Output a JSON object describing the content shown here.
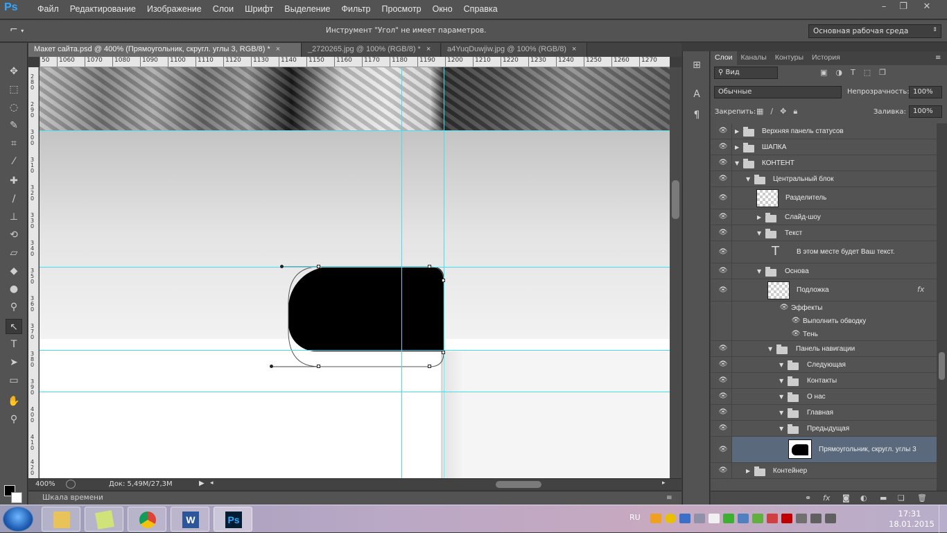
{
  "app": {
    "logo": "Ps"
  },
  "menu": [
    "Файл",
    "Редактирование",
    "Изображение",
    "Слои",
    "Шрифт",
    "Выделение",
    "Фильтр",
    "Просмотр",
    "Окно",
    "Справка"
  ],
  "window_controls": {
    "minimize": "–",
    "restore": "❐",
    "close": "✕"
  },
  "options": {
    "message": "Инструмент \"Угол\" не имеет параметров.",
    "workspace": "Основная рабочая среда"
  },
  "tabs": [
    {
      "label": "Макет сайта.psd @ 400% (Прямоугольник, скругл. углы 3, RGB/8) *",
      "close": "×"
    },
    {
      "label": "_2720265.jpg @ 100% (RGB/8) *",
      "close": "×"
    },
    {
      "label": "a4YuqDuwjiw.jpg @ 100% (RGB/8)",
      "close": "×"
    }
  ],
  "ruler_top": [
    "50",
    "1060",
    "1070",
    "1080",
    "1090",
    "1100",
    "1110",
    "1120",
    "1130",
    "1140",
    "1150",
    "1160",
    "1170",
    "1180",
    "1190",
    "1200",
    "1210",
    "1220",
    "1230",
    "1240",
    "1250",
    "1260",
    "1270"
  ],
  "ruler_left": [
    "280",
    "290",
    "300",
    "310",
    "320",
    "330",
    "340",
    "350",
    "360",
    "370",
    "380",
    "390",
    "400",
    "410",
    "420"
  ],
  "status": {
    "zoom": "400%",
    "doc": "Док: 5,49M/27,3M"
  },
  "timeline": {
    "label": "Шкала времени"
  },
  "panel_tabs": [
    "Слои",
    "Каналы",
    "Контуры",
    "История"
  ],
  "layers_controls": {
    "filter": "Вид",
    "blend_mode": "Обычные",
    "opacity_label": "Непрозрачность:",
    "opacity_value": "100%",
    "lock_label": "Закрепить:",
    "fill_label": "Заливка:",
    "fill_value": "100%"
  },
  "layers": [
    {
      "name": "Верхняя панель статусов",
      "type": "group",
      "indent": 0,
      "expanded": false
    },
    {
      "name": "ШАПКА",
      "type": "group",
      "indent": 0,
      "expanded": false
    },
    {
      "name": "КОНТЕНТ",
      "type": "group",
      "indent": 0,
      "expanded": true
    },
    {
      "name": "Центральный блок",
      "type": "group",
      "indent": 1,
      "expanded": true
    },
    {
      "name": "Разделитель",
      "type": "thumb",
      "indent": 2
    },
    {
      "name": "Слайд-шоу",
      "type": "group",
      "indent": 2,
      "expanded": false
    },
    {
      "name": "Текст",
      "type": "group",
      "indent": 2,
      "expanded": true
    },
    {
      "name": "В этом месте будет Ваш текст.",
      "type": "text",
      "indent": 3
    },
    {
      "name": "Основа",
      "type": "group",
      "indent": 2,
      "expanded": true
    },
    {
      "name": "Подложка",
      "type": "thumb",
      "indent": 3,
      "fx": "fx"
    },
    {
      "name": "Эффекты",
      "type": "effect",
      "indent": 4
    },
    {
      "name": "Выполнить обводку",
      "type": "effect",
      "indent": 5
    },
    {
      "name": "Тень",
      "type": "effect",
      "indent": 5
    },
    {
      "name": "Панель навигации",
      "type": "group",
      "indent": 3,
      "expanded": true
    },
    {
      "name": "Следующая",
      "type": "group",
      "indent": 4,
      "expanded": true
    },
    {
      "name": "Контакты",
      "type": "group",
      "indent": 4,
      "expanded": true
    },
    {
      "name": "О нас",
      "type": "group",
      "indent": 4,
      "expanded": true
    },
    {
      "name": "Главная",
      "type": "group",
      "indent": 4,
      "expanded": true
    },
    {
      "name": "Предыдущая",
      "type": "group",
      "indent": 4,
      "expanded": true
    },
    {
      "name": "Прямоугольник, скругл. углы 3",
      "type": "shape",
      "indent": 5,
      "selected": true
    },
    {
      "name": "Контейнер",
      "type": "group",
      "indent": 1,
      "expanded": false
    }
  ],
  "taskbar": {
    "apps": [
      "Проводник",
      "Записки",
      "Chrome",
      "Word",
      "Photoshop"
    ],
    "glyphs": [
      "",
      "",
      "",
      "W",
      "Ps"
    ],
    "lang": "RU",
    "time": "17:31",
    "date": "18.01.2015"
  },
  "colors": {
    "accent": "#31a8ff",
    "guide": "#3fe0f0",
    "selected_layer": "#5a6a7c"
  }
}
